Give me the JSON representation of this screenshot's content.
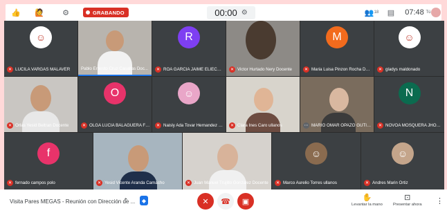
{
  "topbar": {
    "recording_label": "GRABANDO",
    "timer": "00:00",
    "participants_count": "18",
    "clock": "07:48",
    "user_tag": "Tú"
  },
  "tiles": [
    {
      "name": "LUCILA VARGAS MALAVER",
      "kind": "photo",
      "letter": "",
      "color": "#ffffff"
    },
    {
      "name": "Pablo Ernesto Cruz Casallas Doc...",
      "kind": "video",
      "letter": "",
      "color": "#b8b4ae"
    },
    {
      "name": "ROA GARCIA JAIME ELIECER ST",
      "kind": "letter",
      "letter": "R",
      "color": "#7e3ff2"
    },
    {
      "name": "Victor Hurtado Nery Docente",
      "kind": "video",
      "letter": "",
      "color": "#8d8a86"
    },
    {
      "name": "Maria Luisa Pinzon Rocha Doc...",
      "kind": "letter",
      "letter": "M",
      "color": "#f26b1d"
    },
    {
      "name": "gladys maldonado",
      "kind": "photo",
      "letter": "",
      "color": "#ffffff"
    },
    {
      "name": "Orlas Yesid Beltran Docente",
      "kind": "video",
      "letter": "",
      "color": "#c9c6c2"
    },
    {
      "name": "OLGA LUCIA BALAGUERA Func...",
      "kind": "letter",
      "letter": "O",
      "color": "#e8336a"
    },
    {
      "name": "Naisly Ada Tovar Hernandez Fu...",
      "kind": "photo",
      "letter": "",
      "color": "#ffffff"
    },
    {
      "name": "Clara Ines Caro ullanos",
      "kind": "video",
      "letter": "",
      "color": "#d8d4cc"
    },
    {
      "name": "MARIO OMAR OPAZO GUTIERR...",
      "kind": "video",
      "letter": "",
      "color": "#7a6c5d"
    },
    {
      "name": "NOVOA MOSQUERA JHOAN AL...",
      "kind": "letter",
      "letter": "N",
      "color": "#0b6b4f"
    },
    {
      "name": "fernado campos polo",
      "kind": "letter",
      "letter": "f",
      "color": "#e8336a"
    },
    {
      "name": "Yesid Vicente Aranda Camacho",
      "kind": "video",
      "letter": "",
      "color": "#a7b5bf"
    },
    {
      "name": "Juan Manuel Trujillo Gonzalez Docente",
      "kind": "video",
      "letter": "",
      "color": "#d6d2cd"
    },
    {
      "name": "Marco Aurelio Torres ullanos",
      "kind": "photo",
      "letter": "",
      "color": "#ffffff"
    },
    {
      "name": "Andres Marin Ortiz",
      "kind": "photo",
      "letter": "",
      "color": "#ffffff"
    }
  ],
  "bottombar": {
    "meeting_title": "Visita Pares MEGAS - Reunión con Dirección de ...",
    "raise_hand_label": "Levantar la mano",
    "present_label": "Presentar ahora"
  }
}
